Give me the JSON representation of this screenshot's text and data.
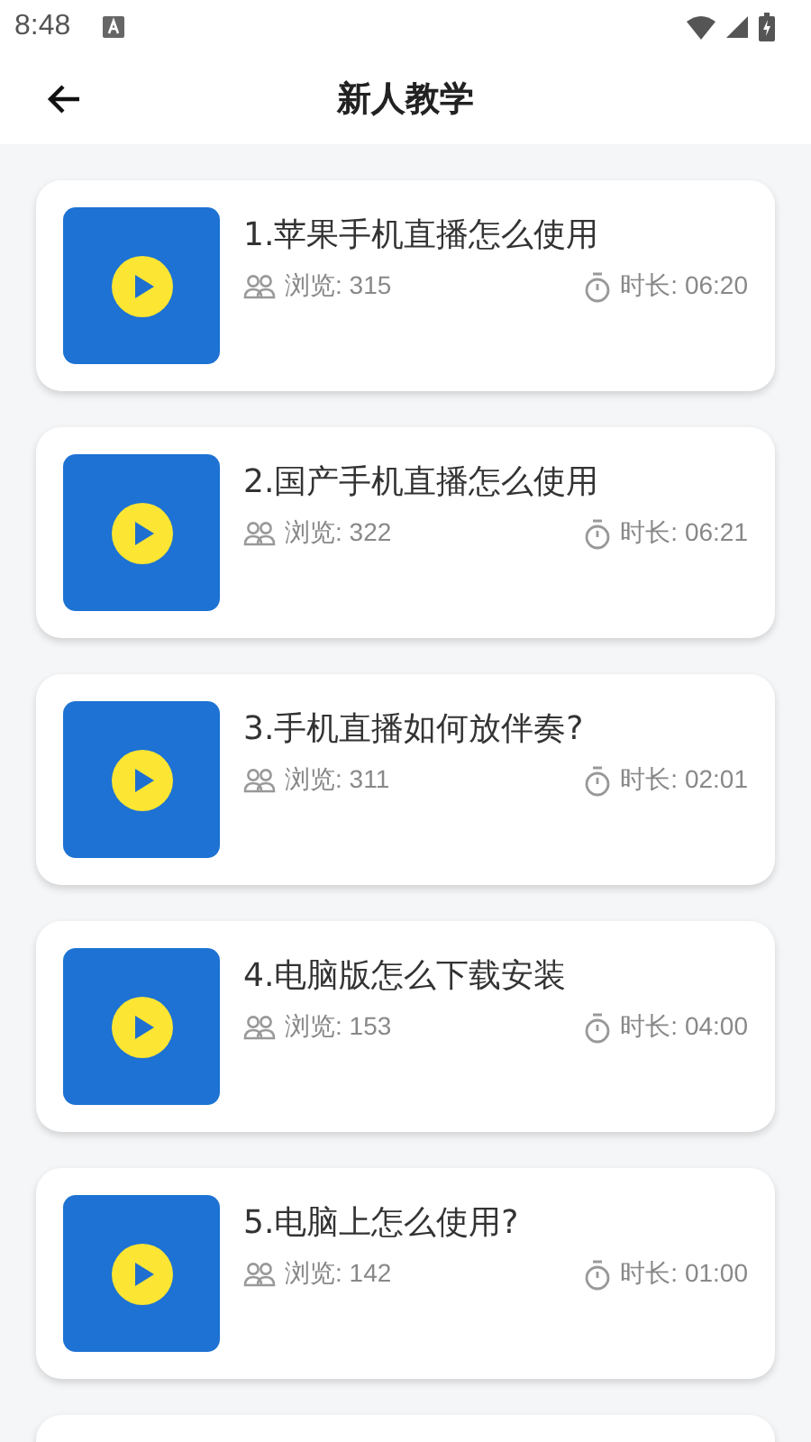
{
  "status_bar": {
    "time": "8:48"
  },
  "header": {
    "title": "新人教学"
  },
  "lessons": [
    {
      "title": "1.苹果手机直播怎么使用",
      "views": "浏览: 315",
      "duration": "时长: 06:20"
    },
    {
      "title": "2.国产手机直播怎么使用",
      "views": "浏览: 322",
      "duration": "时长: 06:21"
    },
    {
      "title": "3.手机直播如何放伴奏?",
      "views": "浏览: 311",
      "duration": "时长: 02:01"
    },
    {
      "title": "4.电脑版怎么下载安装",
      "views": "浏览: 153",
      "duration": "时长: 04:00"
    },
    {
      "title": "5.电脑上怎么使用?",
      "views": "浏览: 142",
      "duration": "时长: 01:00"
    }
  ]
}
